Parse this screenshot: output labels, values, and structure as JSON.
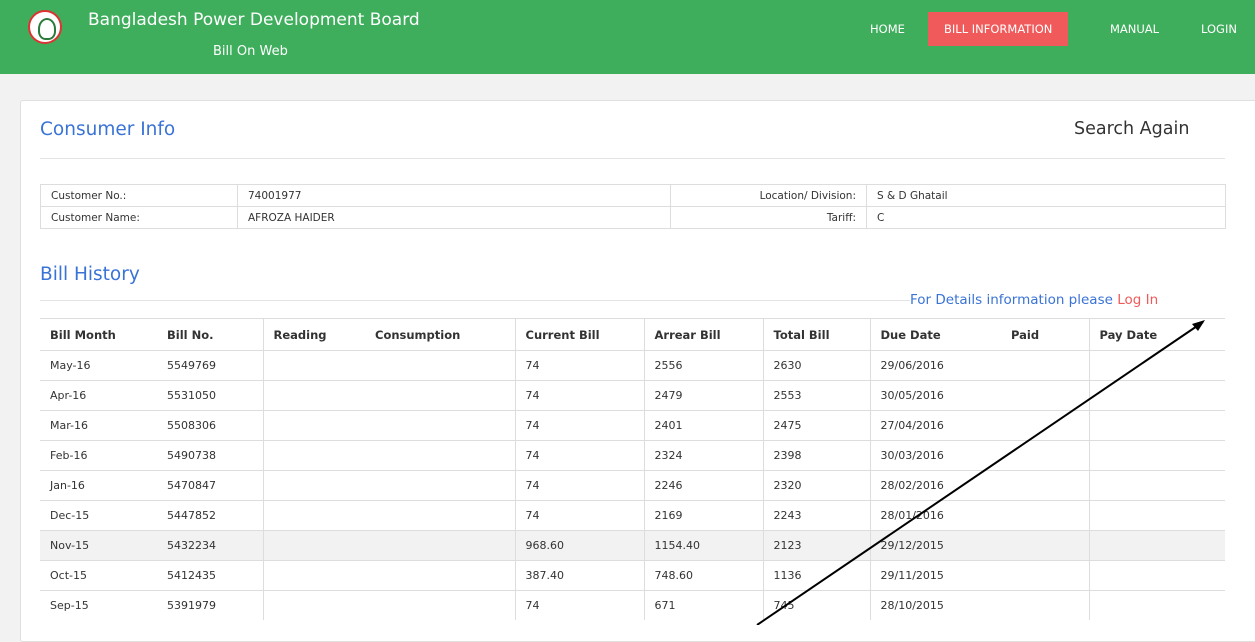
{
  "header": {
    "title": "Bangladesh Power Development Board",
    "subtitle": "Bill On Web",
    "nav": [
      {
        "label": "HOME"
      },
      {
        "label": "BILL INFORMATION",
        "active": true
      },
      {
        "label": "MANUAL"
      },
      {
        "label": "LOGIN"
      }
    ],
    "brand_color": "#3eae5c",
    "active_color": "#f05a5a"
  },
  "consumer": {
    "title": "Consumer Info",
    "search_again": "Search Again",
    "customer_no_label": "Customer No.:",
    "customer_no": "74001977",
    "customer_name_label": "Customer Name:",
    "customer_name": "AFROZA HAIDER",
    "location_label": "Location/ Division:",
    "location": "S & D Ghatail",
    "tariff_label": "Tariff:",
    "tariff": "C"
  },
  "bill_history": {
    "title": "Bill History",
    "note": "For Details information please ",
    "login_link": "Log In",
    "columns": [
      "Bill Month",
      "Bill No.",
      "Reading",
      "Consumption",
      "Current Bill",
      "Arrear Bill",
      "Total Bill",
      "Due Date",
      "Paid",
      "Pay Date"
    ],
    "rows": [
      [
        "May-16",
        "5549769",
        "",
        "",
        "74",
        "2556",
        "2630",
        "29/06/2016",
        "",
        ""
      ],
      [
        "Apr-16",
        "5531050",
        "",
        "",
        "74",
        "2479",
        "2553",
        "30/05/2016",
        "",
        ""
      ],
      [
        "Mar-16",
        "5508306",
        "",
        "",
        "74",
        "2401",
        "2475",
        "27/04/2016",
        "",
        ""
      ],
      [
        "Feb-16",
        "5490738",
        "",
        "",
        "74",
        "2324",
        "2398",
        "30/03/2016",
        "",
        ""
      ],
      [
        "Jan-16",
        "5470847",
        "",
        "",
        "74",
        "2246",
        "2320",
        "28/02/2016",
        "",
        ""
      ],
      [
        "Dec-15",
        "5447852",
        "",
        "",
        "74",
        "2169",
        "2243",
        "28/01/2016",
        "",
        ""
      ],
      [
        "Nov-15",
        "5432234",
        "",
        "",
        "968.60",
        "1154.40",
        "2123",
        "29/12/2015",
        "",
        ""
      ],
      [
        "Oct-15",
        "5412435",
        "",
        "",
        "387.40",
        "748.60",
        "1136",
        "29/11/2015",
        "",
        ""
      ],
      [
        "Sep-15",
        "5391979",
        "",
        "",
        "74",
        "671",
        "745",
        "28/10/2015",
        "",
        ""
      ]
    ]
  }
}
